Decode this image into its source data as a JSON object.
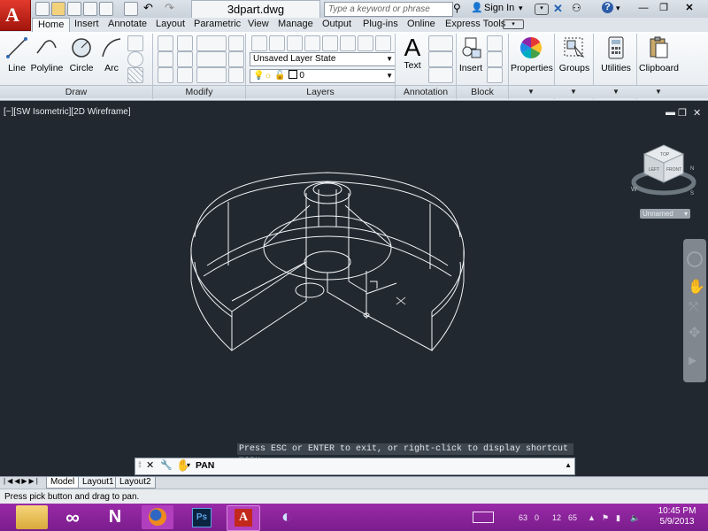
{
  "window": {
    "file_name": "3dpart.dwg",
    "search_placeholder": "Type a keyword or phrase",
    "sign_in": "Sign In",
    "help": "?"
  },
  "tabs": [
    "Home",
    "Insert",
    "Annotate",
    "Layout",
    "Parametric",
    "View",
    "Manage",
    "Output",
    "Plug-ins",
    "Online",
    "Express Tools"
  ],
  "ribbon": {
    "draw": {
      "title": "Draw",
      "line": "Line",
      "polyline": "Polyline",
      "circle": "Circle",
      "arc": "Arc"
    },
    "modify": {
      "title": "Modify"
    },
    "layers": {
      "title": "Layers",
      "layer_state": "Unsaved Layer State",
      "current_layer": "0"
    },
    "annotation": {
      "title": "Annotation",
      "text": "Text"
    },
    "block": {
      "title": "Block",
      "insert": "Insert"
    },
    "properties": "Properties",
    "groups": "Groups",
    "utilities": "Utilities",
    "clipboard": "Clipboard"
  },
  "viewport": {
    "label": "[−][SW Isometric][2D Wireframe]",
    "viewcube": {
      "top": "TOP",
      "left": "LEFT",
      "front": "FRONT",
      "n": "N",
      "w": "W",
      "s": "S"
    },
    "ucs": "Unnamed"
  },
  "command": {
    "message": "Press ESC or ENTER to exit, or right-click to display shortcut menu.",
    "current": "PAN"
  },
  "layouts": [
    "Model",
    "Layout1",
    "Layout2"
  ],
  "status": "Press pick button and drag to pan.",
  "taskbar": {
    "tray_numbers": [
      "63",
      "0",
      "12",
      "65"
    ],
    "time": "10:45 PM",
    "date": "5/9/2013"
  },
  "colors": {
    "accent_red": "#c2281c",
    "viewport_bg": "#212830",
    "taskbar": "#8a23a0"
  }
}
